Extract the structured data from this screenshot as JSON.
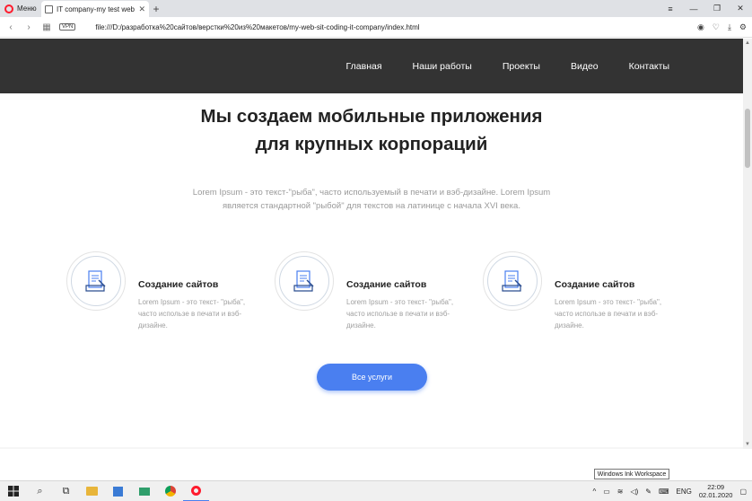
{
  "browser": {
    "menu_label": "Меню",
    "tab_title": "IT company-my test web si",
    "url": "file:///D:/разработка%20сайтов/верстки%20из%20макетов/my-web-sit-coding-it-company/index.html",
    "vpn_label": "VPN"
  },
  "nav": {
    "items": [
      "Главная",
      "Наши работы",
      "Проекты",
      "Видео",
      "Контакты"
    ]
  },
  "hero": {
    "title_line1": "Мы создаем мобильные приложения",
    "title_line2": "для крупных корпораций",
    "subtitle": "Lorem Ipsum - это текст-\"рыба\", часто используемый в печати и вэб-дизайне. Lorem Ipsum является стандартной \"рыбой\" для текстов на латинице с начала XVI века."
  },
  "services": [
    {
      "title": "Создание сайтов",
      "desc": "Lorem Ipsum - это текст- \"рыба\", часто использе в печати и вэб-дизайне."
    },
    {
      "title": "Создание сайтов",
      "desc": "Lorem Ipsum - это текст- \"рыба\", часто использе в печати и вэб-дизайне."
    },
    {
      "title": "Создание сайтов",
      "desc": "Lorem Ipsum - это текст- \"рыба\", часто использе в печати и вэб-дизайне."
    }
  ],
  "cta": {
    "label": "Все услуги"
  },
  "taskbar": {
    "tooltip": "Windows Ink Workspace",
    "lang": "ENG",
    "time": "22:09",
    "date": "02.01.2020"
  },
  "colors": {
    "header_bg": "#333333",
    "accent": "#4a7ff0"
  }
}
